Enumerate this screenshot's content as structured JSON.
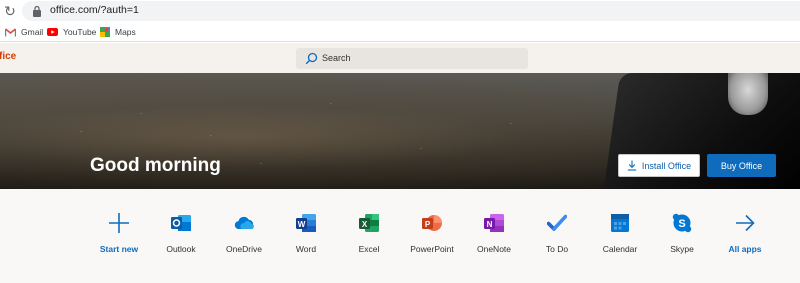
{
  "browser": {
    "url": "office.com/?auth=1",
    "bookmarks": [
      {
        "label": "Gmail",
        "icon": "gmail-icon"
      },
      {
        "label": "YouTube",
        "icon": "youtube-icon"
      },
      {
        "label": "Maps",
        "icon": "maps-icon"
      }
    ]
  },
  "header": {
    "brand": "fice",
    "search_placeholder": "Search"
  },
  "hero": {
    "greeting": "Good morning",
    "install_label": "Install Office",
    "buy_label": "Buy Office"
  },
  "apps": [
    {
      "label": "Start new",
      "icon": "plus-icon"
    },
    {
      "label": "Outlook",
      "icon": "outlook-icon"
    },
    {
      "label": "OneDrive",
      "icon": "onedrive-icon"
    },
    {
      "label": "Word",
      "icon": "word-icon"
    },
    {
      "label": "Excel",
      "icon": "excel-icon"
    },
    {
      "label": "PowerPoint",
      "icon": "powerpoint-icon"
    },
    {
      "label": "OneNote",
      "icon": "onenote-icon"
    },
    {
      "label": "To Do",
      "icon": "todo-icon"
    },
    {
      "label": "Calendar",
      "icon": "calendar-icon"
    },
    {
      "label": "Skype",
      "icon": "skype-icon"
    },
    {
      "label": "All apps",
      "icon": "arrow-right-icon"
    }
  ],
  "colors": {
    "brand": "#d83b01",
    "accent": "#0f6cbd"
  }
}
